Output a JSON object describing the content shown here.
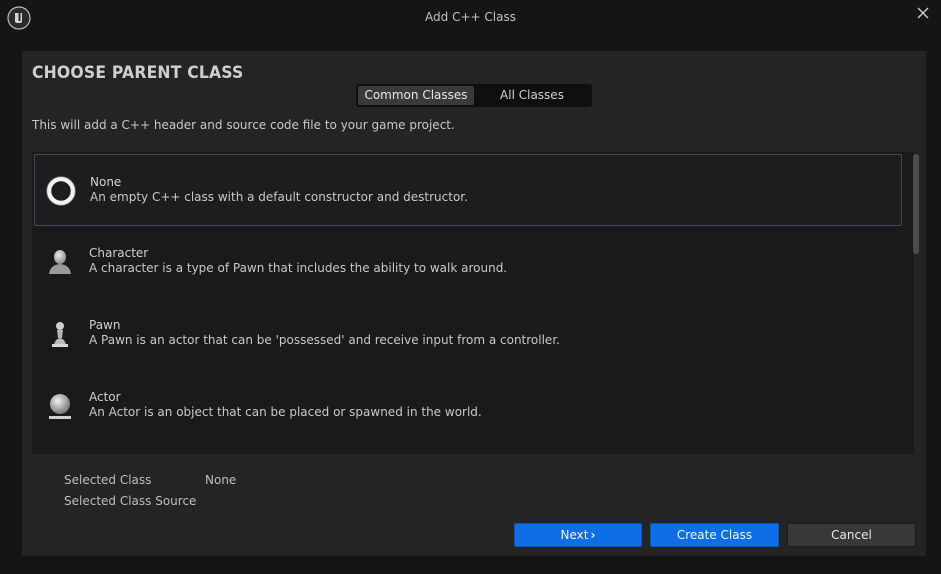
{
  "window": {
    "title": "Add C++ Class"
  },
  "header": {
    "heading": "CHOOSE PARENT CLASS",
    "tabs": [
      {
        "label": "Common Classes",
        "active": true
      },
      {
        "label": "All Classes",
        "active": false
      }
    ],
    "description": "This will add a C++ header and source code file to your game project."
  },
  "classes": [
    {
      "name": "None",
      "description": "An empty C++ class with a default constructor and destructor.",
      "icon": "none-ring-icon",
      "selected": true
    },
    {
      "name": "Character",
      "description": "A character is a type of Pawn that includes the ability to walk around.",
      "icon": "character-icon",
      "selected": false
    },
    {
      "name": "Pawn",
      "description": "A Pawn is an actor that can be 'possessed' and receive input from a controller.",
      "icon": "pawn-icon",
      "selected": false
    },
    {
      "name": "Actor",
      "description": "An Actor is an object that can be placed or spawned in the world.",
      "icon": "actor-sphere-icon",
      "selected": false
    }
  ],
  "selection": {
    "class_label": "Selected Class",
    "class_value": "None",
    "source_label": "Selected Class Source",
    "source_value": ""
  },
  "buttons": {
    "next": "Next",
    "create": "Create Class",
    "cancel": "Cancel"
  },
  "colors": {
    "primary_button": "#0e6ee6",
    "panel": "#242424",
    "background": "#151515"
  }
}
